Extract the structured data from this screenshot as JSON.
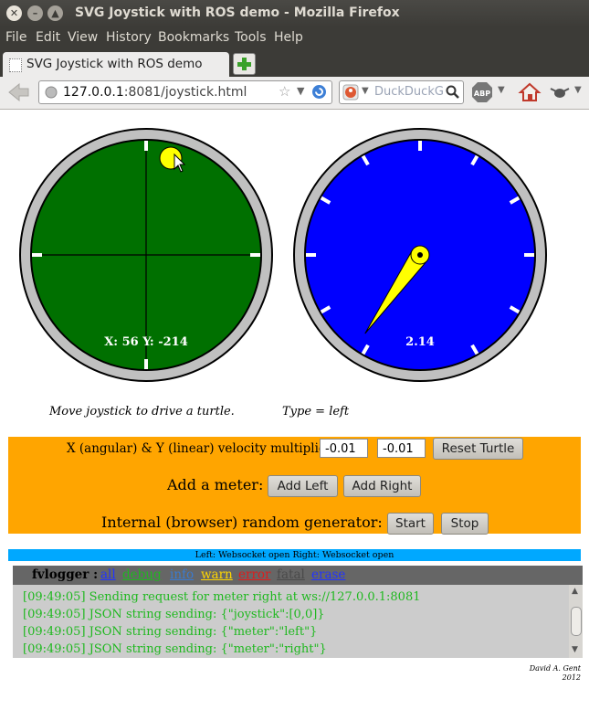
{
  "window": {
    "title": "SVG Joystick with ROS demo - Mozilla Firefox"
  },
  "menu": {
    "items": [
      "File",
      "Edit",
      "View",
      "History",
      "Bookmarks",
      "Tools",
      "Help"
    ]
  },
  "tab": {
    "title": "SVG Joystick with ROS demo"
  },
  "address": {
    "host": "127.0.0.1",
    "rest": ":8081/joystick.html"
  },
  "search": {
    "placeholder": "DuckDuckG"
  },
  "colors": {
    "joystick_face": "#007000",
    "meter_face": "#0000ff",
    "knob": "#ffff00",
    "panel": "#ffa500",
    "status_bar": "#00a8ff",
    "log_text": "#1fb81f"
  },
  "joystick": {
    "readout": "X: 56 Y: -214"
  },
  "meter": {
    "readout": "2.14",
    "needle_angle_deg": 215
  },
  "captions": {
    "joystick": "Move joystick to drive a turtle.",
    "meter": "Type = left"
  },
  "controls": {
    "multipliers_label": "X (angular) & Y (linear) velocity multipliers",
    "x_multiplier": "-0.01",
    "y_multiplier": "-0.01",
    "reset_label": "Reset Turtle",
    "add_meter_label": "Add a meter:",
    "add_left_label": "Add Left",
    "add_right_label": "Add Right",
    "generator_label": "Internal (browser) random generator:",
    "start_label": "Start",
    "stop_label": "Stop"
  },
  "status": {
    "text": "Left: Websocket open Right: Websocket open"
  },
  "logger": {
    "title": "fvlogger :",
    "filters": [
      "all",
      "debug",
      "info",
      "warn",
      "error",
      "fatal",
      "erase"
    ],
    "lines": [
      "[09:49:05] Sending request for meter right at ws://127.0.0.1:8081",
      "[09:49:05] JSON string sending: {\"joystick\":[0,0]}",
      "[09:49:05] JSON string sending: {\"meter\":\"left\"}",
      "[09:49:05] JSON string sending: {\"meter\":\"right\"}"
    ]
  },
  "credit": {
    "name": "David A. Gent",
    "year": "2012"
  }
}
